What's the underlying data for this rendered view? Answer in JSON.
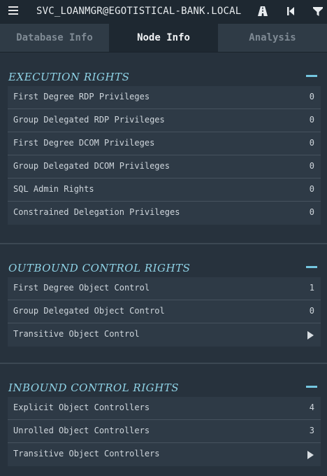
{
  "header": {
    "title": "SVC_LOANMGR@EGOTISTICAL-BANK.LOCAL"
  },
  "tabs": [
    {
      "label": "Database Info"
    },
    {
      "label": "Node Info",
      "active": true
    },
    {
      "label": "Analysis"
    }
  ],
  "sections": [
    {
      "title": "EXECUTION RIGHTS",
      "rows": [
        {
          "label": "First Degree RDP Privileges",
          "value": "0"
        },
        {
          "label": "Group Delegated RDP Privileges",
          "value": "0"
        },
        {
          "label": "First Degree DCOM Privileges",
          "value": "0"
        },
        {
          "label": "Group Delegated DCOM Privileges",
          "value": "0"
        },
        {
          "label": "SQL Admin Rights",
          "value": "0"
        },
        {
          "label": "Constrained Delegation Privileges",
          "value": "0"
        }
      ]
    },
    {
      "title": "OUTBOUND CONTROL RIGHTS",
      "rows": [
        {
          "label": "First Degree Object Control",
          "value": "1"
        },
        {
          "label": "Group Delegated Object Control",
          "value": "0"
        },
        {
          "label": "Transitive Object Control"
        }
      ]
    },
    {
      "title": "INBOUND CONTROL RIGHTS",
      "rows": [
        {
          "label": "Explicit Object Controllers",
          "value": "4"
        },
        {
          "label": "Unrolled Object Controllers",
          "value": "3"
        },
        {
          "label": "Transitive Object Controllers"
        }
      ]
    }
  ],
  "icons": {
    "menu": "menu-icon",
    "pathfinding": "road-icon",
    "back": "step-back-icon",
    "filter": "filter-icon",
    "expand": "play-arrow-icon"
  },
  "colors": {
    "accent": "#74c6e0",
    "section_title": "#8fd3e6",
    "row_bg": "#2e3a46",
    "background": "#27323d"
  }
}
